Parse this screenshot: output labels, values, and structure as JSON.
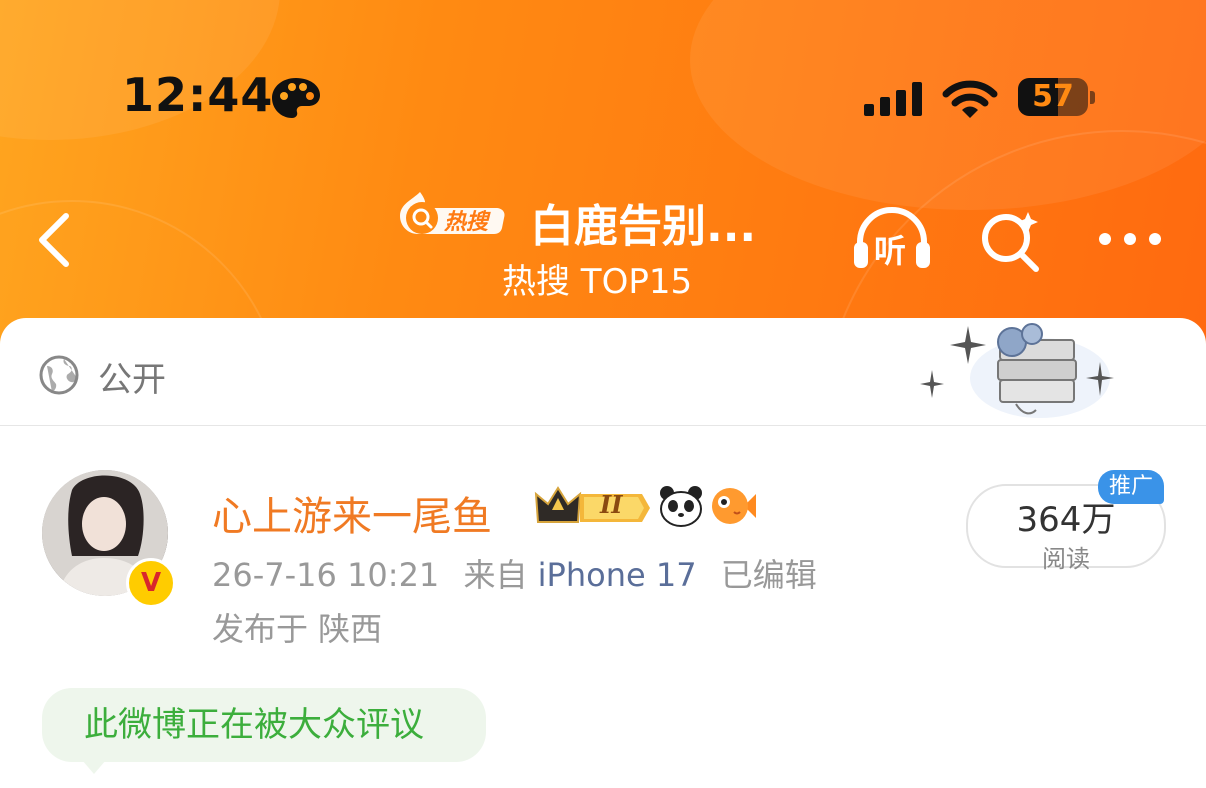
{
  "status_bar": {
    "time": "12:44",
    "battery": "57"
  },
  "nav": {
    "badge_label": "热搜",
    "title": "白鹿告别...",
    "subtitle": "热搜 TOP15",
    "listen_label": "听"
  },
  "post": {
    "visibility": "公开",
    "username": "心上游来一尾鱼",
    "member_level": "II",
    "timestamp": "26-7-16 10:21",
    "source_prefix": "来自",
    "device": "iPhone 17",
    "edited": "已编辑",
    "location": "发布于 陕西",
    "verified_mark": "V",
    "reads_count": "364万",
    "reads_label": "阅读",
    "promo_badge": "推广",
    "debate_tag": "此微博正在被大众评议"
  },
  "colors": {
    "header_start": "#ffa51f",
    "header_end": "#ff6a10",
    "username": "#f07a23",
    "device_link": "#5a6e99",
    "debate_text": "#3cae3c",
    "promo": "#3a93e8"
  }
}
